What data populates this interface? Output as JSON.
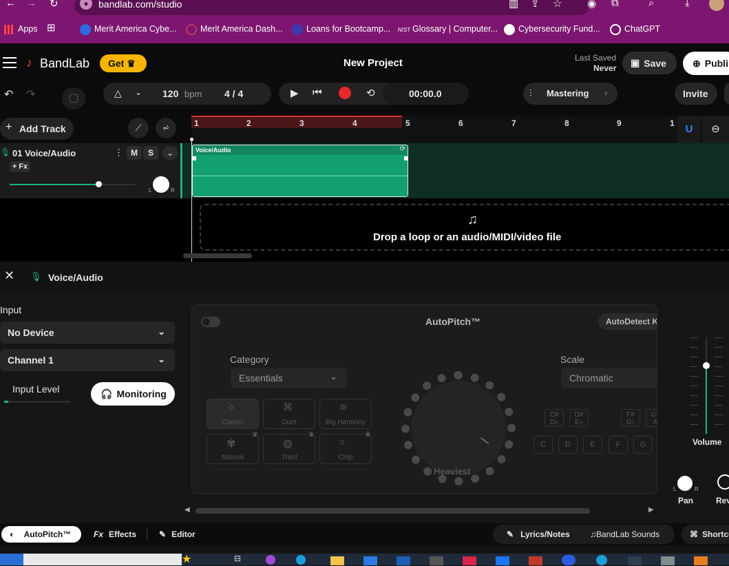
{
  "browser": {
    "url": "bandlab.com/studio",
    "bookmarks": [
      {
        "label": "Apps"
      },
      {
        "label": "Merit America Cybe..."
      },
      {
        "label": "Merit America Dash..."
      },
      {
        "label": "Loans for Bootcamp..."
      },
      {
        "label": "Glossary | Computer..."
      },
      {
        "label": "Cybersecurity Fund..."
      },
      {
        "label": "ChatGPT"
      }
    ]
  },
  "header": {
    "brand": "BandLab",
    "get_label": "Get",
    "project_title": "New Project",
    "last_saved_label": "Last Saved",
    "last_saved_value": "Never",
    "save_label": "Save",
    "publish_label": "Publi"
  },
  "transport": {
    "bpm_value": "120",
    "bpm_unit": "bpm",
    "time_sig": "4 / 4",
    "time": "00:00.0",
    "mastering_label": "Mastering",
    "invite_label": "Invite"
  },
  "tracks": {
    "add_label": "Add Track",
    "items": [
      {
        "name": "01  Voice/Audio",
        "fx": "+ Fx",
        "mute": "M",
        "solo": "S",
        "pan_l": "L",
        "pan_r": "R",
        "clip_label": "Voice/Audio"
      }
    ],
    "drop_text": "Drop a loop or an audio/MIDI/video file",
    "ruler": [
      "1",
      "2",
      "3",
      "4",
      "5",
      "6",
      "7",
      "8",
      "9",
      "1"
    ]
  },
  "panel": {
    "track_name": "Voice/Audio",
    "input_label": "Input",
    "device_value": "No Device",
    "channel_value": "Channel 1",
    "input_level_label": "Input Level",
    "monitoring_label": "Monitoring",
    "autopitch": {
      "title": "AutoPitch™",
      "autodetect_label": "AutoDetect K",
      "category_label": "Category",
      "category_value": "Essentials",
      "scale_label": "Scale",
      "scale_value": "Chromatic",
      "presets": [
        "Classic",
        "Duet",
        "Big Harmony",
        "Natural",
        "Third",
        "Chip"
      ],
      "knob_label": "Heaviest",
      "sharp_keys": [
        [
          "C#",
          "D♭"
        ],
        [
          "D#",
          "E♭"
        ],
        [
          "F#",
          "G♭"
        ],
        [
          "G#",
          "A"
        ]
      ],
      "keys": [
        "C",
        "D",
        "E",
        "F",
        "G"
      ]
    },
    "volume_label": "Volume",
    "pan_label": "Pan",
    "pan_l": "L",
    "pan_r": "R",
    "reverb_label": "Rev"
  },
  "bottom_tabs": {
    "autopitch": "AutoPitch™",
    "effects": "Effects",
    "editor": "Editor",
    "lyrics": "Lyrics/Notes",
    "sounds": "BandLab Sounds",
    "shortcuts": "Shortcu"
  },
  "colors": {
    "accent_green": "#14875f",
    "record_red": "#e8262e",
    "get_yellow": "#f7b500",
    "chrome_purple": "#7d1670"
  }
}
